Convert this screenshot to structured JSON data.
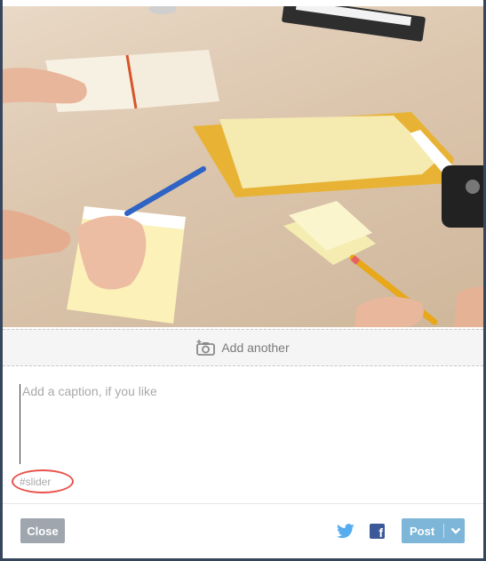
{
  "composer": {
    "add_another_label": "Add another",
    "caption_placeholder": "Add a caption, if you like",
    "tag": "#slider"
  },
  "footer": {
    "close_label": "Close",
    "post_label": "Post"
  },
  "colors": {
    "post_button": "#529ecc",
    "close_button": "#9fa6ad",
    "tag_highlight": "#e9534c",
    "twitter": "#55acee",
    "facebook": "#3b5998"
  },
  "icons": [
    "camera-plus-icon",
    "twitter-icon",
    "facebook-icon",
    "chevron-down-icon"
  ]
}
